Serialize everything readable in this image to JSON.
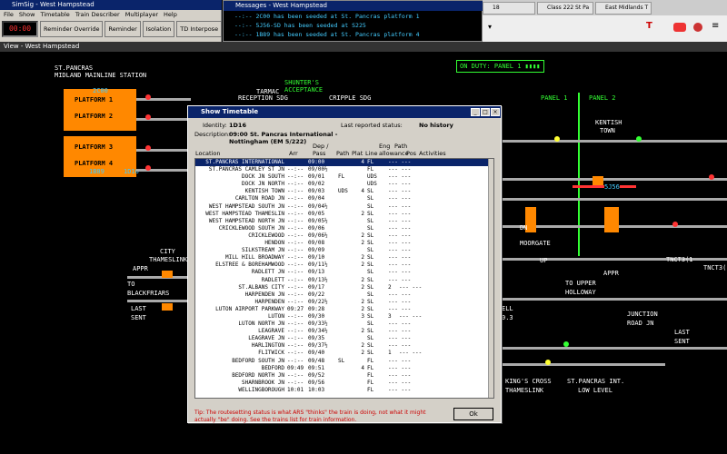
{
  "simsig": {
    "title": "SimSig - West Hampstead",
    "menu": [
      "File",
      "Show",
      "Timetable",
      "Train Describer",
      "Multiplayer",
      "Help"
    ],
    "clock": "00:00",
    "toolbar": [
      "Reminder Override",
      "Reminder",
      "Isolation",
      "TD Interpose"
    ]
  },
  "messages": {
    "title": "Messages - West Hampstead",
    "lines": [
      "--:-- 2C00 has been seeded at St. Pancras platform 1",
      "--:-- 5J56-SD has been seeded at S225",
      "--:-- 1B89 has been seeded at St. Pancras platform 4"
    ]
  },
  "browser": {
    "tabs": [
      "18",
      "Class 222 St Pa",
      "East Midlands T"
    ]
  },
  "main": {
    "title": "View - West Hampstead",
    "station": "ST.PANCRAS",
    "station2": "MIDLAND MAINLINE STATION",
    "shunter": "SHUNTER'S",
    "acceptance": "ACCEPTANCE",
    "tarmac": "TARMAC",
    "reception": "RECEPTION SDG",
    "cripple": "CRIPPLE SDG",
    "platforms": [
      "PLATFORM 1",
      "PLATFORM 2",
      "PLATFORM 3",
      "PLATFORM 4"
    ],
    "desc_top": "2C00",
    "desc_bottom": "1B89",
    "desc_bottom2": "1D16",
    "on_duty": "ON DUTY: PANEL 1",
    "panel1": "PANEL 1",
    "panel2": "PANEL 2",
    "kentish": "KENTISH",
    "town": "TOWN",
    "moorgate": "MOORGATE",
    "up": "UP",
    "dn": "DN",
    "up2": "UP",
    "sj56": "5J56",
    "city": "CITY",
    "thameslink": "THAMESLINK",
    "appr": "APPR",
    "to": "TO",
    "blackfriars": "BLACKFRIARS",
    "last": "LAST",
    "sent": "SENT",
    "appr2": "APPR",
    "to_upper": "TO UPPER",
    "holloway": "HOLLOWAY",
    "junction": "JUNCTION",
    "road_jn": "ROAD JN",
    "last2": "LAST",
    "sent2": "SENT",
    "tnct3": "TNCT3(1",
    "tnct3b": "TNCT3(",
    "kings": "KING'S CROSS",
    "thameslink2": "THAMESLINK",
    "stp_int": "ST.PANCRAS INT.",
    "low_level": "LOW LEVEL",
    "ell": "ELL",
    "ell2": "0.3"
  },
  "dialog": {
    "title": "Show Timetable",
    "identity_label": "Identity:",
    "identity": "1D16",
    "last_status_label": "Last reported status:",
    "last_status": "No history",
    "description_label": "Description:",
    "description": "09:00 St. Pancras International -",
    "description2": "Nottingham (EM 5/222)",
    "headers": {
      "location": "Location",
      "arr": "Arr",
      "dep": "Dep /",
      "pass": "Pass",
      "path": "Path",
      "plat": "Plat",
      "line": "Line",
      "eng": "Eng",
      "allow": "allowance",
      "pathc": "Path",
      "pos": "Pos",
      "activities": "Activities"
    },
    "rows": [
      [
        "ST.PANCRAS INTERNATIONAL",
        "",
        "09:00",
        "",
        "4",
        "FL"
      ],
      [
        "ST.PANCRAS CAMLEY ST JN",
        "--:--",
        "09/00½",
        "",
        "",
        "FL"
      ],
      [
        "DOCK JN SOUTH",
        "--:--",
        "09/01",
        "FL",
        "",
        "UDS"
      ],
      [
        "DOCK JN NORTH",
        "--:--",
        "09/02",
        "",
        "",
        "UDS"
      ],
      [
        "KENTISH TOWN",
        "--:--",
        "09/03",
        "UDS",
        "4",
        "SL"
      ],
      [
        "CARLTON ROAD JN",
        "--:--",
        "09/04",
        "",
        "",
        "SL"
      ],
      [
        "WEST HAMPSTEAD SOUTH JN",
        "--:--",
        "09/04½",
        "",
        "",
        "SL"
      ],
      [
        "WEST HAMPSTEAD THAMESLIN",
        "--:--",
        "09/05",
        "",
        "2",
        "SL"
      ],
      [
        "WEST HAMPSTEAD NORTH JN",
        "--:--",
        "09/05½",
        "",
        "",
        "SL"
      ],
      [
        "CRICKLEWOOD SOUTH JN",
        "--:--",
        "09/06",
        "",
        "",
        "SL"
      ],
      [
        "CRICKLEWOOD",
        "--:--",
        "09/06½",
        "",
        "2",
        "SL"
      ],
      [
        "HENDON",
        "--:--",
        "09/08",
        "",
        "2",
        "SL"
      ],
      [
        "SILKSTREAM JN",
        "--:--",
        "09/09",
        "",
        "",
        "SL"
      ],
      [
        "MILL HILL BROADWAY",
        "--:--",
        "09/10",
        "",
        "2",
        "SL"
      ],
      [
        "ELSTREE & BOREHAMWOOD",
        "--:--",
        "09/11½",
        "",
        "2",
        "SL"
      ],
      [
        "RADLETT JN",
        "--:--",
        "09/13",
        "",
        "",
        "SL"
      ],
      [
        "RADLETT",
        "--:--",
        "09/13½",
        "",
        "2",
        "SL"
      ],
      [
        "ST.ALBANS CITY",
        "--:--",
        "09/17",
        "",
        "2",
        "SL"
      ],
      [
        "HARPENDEN JN",
        "--:--",
        "09/22",
        "",
        "",
        "SL"
      ],
      [
        "HARPENDEN",
        "--:--",
        "09/22½",
        "",
        "2",
        "SL"
      ],
      [
        "LUTON AIRPORT PARKWAY",
        "09:27",
        "09:28",
        "",
        "2",
        "SL"
      ],
      [
        "LUTON",
        "--:--",
        "09/30",
        "",
        "3",
        "SL"
      ],
      [
        "LUTON NORTH JN",
        "--:--",
        "09/33½",
        "",
        "",
        "SL"
      ],
      [
        "LEAGRAVE",
        "--:--",
        "09/34½",
        "",
        "2",
        "SL"
      ],
      [
        "LEAGRAVE JN",
        "--:--",
        "09/35",
        "",
        "",
        "SL"
      ],
      [
        "HARLINGTON",
        "--:--",
        "09/37½",
        "",
        "2",
        "SL"
      ],
      [
        "FLITWICK",
        "--:--",
        "09/40",
        "",
        "2",
        "SL"
      ],
      [
        "BEDFORD SOUTH JN",
        "--:--",
        "09/48",
        "SL",
        "",
        "FL"
      ],
      [
        "BEDFORD",
        "09:49",
        "09:51",
        "",
        "4",
        "FL"
      ],
      [
        "BEDFORD NORTH JN",
        "--:--",
        "09/52",
        "",
        "",
        "FL"
      ],
      [
        "SHARNBROOK JN",
        "--:--",
        "09/56",
        "",
        "",
        "FL"
      ],
      [
        "WELLINGBOROUGH",
        "10:01",
        "10:03",
        "",
        "",
        "FL"
      ]
    ],
    "extra": {
      "KENTISH TOWN": "",
      "ST.ALBANS CITY": "2",
      "LUTON": "3",
      "FLITWICK": "1"
    },
    "tip": "Tip: The routesetting status is what ARS \"thinks\" the train is doing, not what it might actually \"be\" doing. See the trains list for train information.",
    "ok": "Ok"
  }
}
